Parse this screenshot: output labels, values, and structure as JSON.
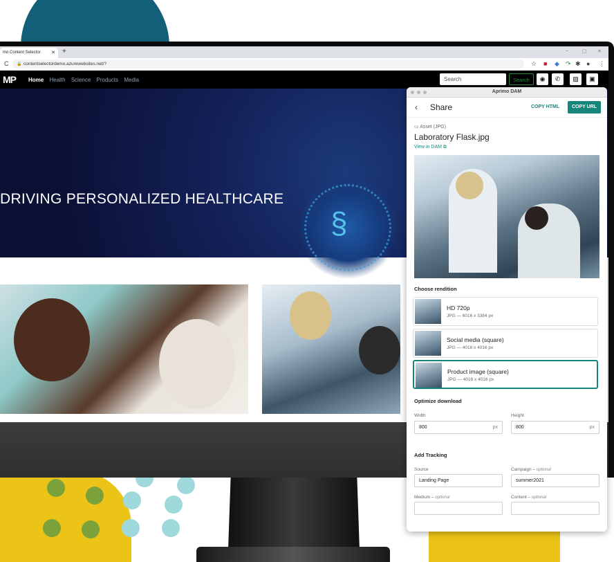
{
  "browser": {
    "tab_title": "mo Content Selector",
    "url": "contentselectordemo.azurewebsites.net/?"
  },
  "site": {
    "logo": "MP",
    "nav": [
      "Home",
      "Health",
      "Science",
      "Products",
      "Media"
    ],
    "search_placeholder": "Search",
    "search_button": "Search",
    "hero_title": "DRIVING PERSONALIZED HEALTHCARE"
  },
  "panel": {
    "window_title": "Aprimo DAM",
    "header": "Share",
    "copy_html": "COPY HTML",
    "copy_url": "COPY URL",
    "asset_type": "Asset (JPG)",
    "asset_name": "Laboratory Flask.jpg",
    "view_in_dam": "View in DAM",
    "choose_rendition": "Choose rendition",
    "renditions": [
      {
        "name": "HD 720p",
        "meta": "JPG — 6016 x 3384 px"
      },
      {
        "name": "Social media (square)",
        "meta": "JPG — 4016 x 4016 px"
      },
      {
        "name": "Product image (square)",
        "meta": "JPG — 4016 x 4016 px"
      }
    ],
    "optimize_download": "Optimize download",
    "width_label": "Width",
    "width_value": "800",
    "height_label": "Height",
    "height_value": "800",
    "unit": "px",
    "add_tracking": "Add Tracking",
    "source_label": "Source",
    "source_value": "Landing Page",
    "campaign_label": "Campaign",
    "campaign_value": "summer2021",
    "medium_label": "Medium",
    "content_label": "Content",
    "optional": "optional"
  },
  "colors": {
    "accent": "#16857a",
    "brand_teal": "#135f7a",
    "deco_yellow": "#ecc418"
  }
}
